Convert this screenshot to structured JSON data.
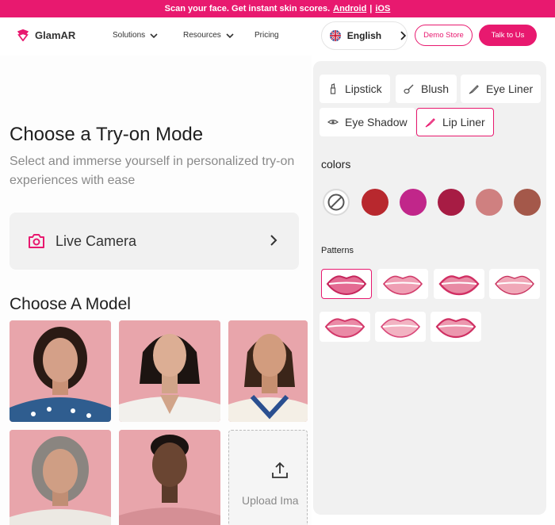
{
  "banner": {
    "text": "Scan your face. Get instant skin scores.",
    "android": "Android",
    "separator": "|",
    "ios": "iOS"
  },
  "nav": {
    "brand": "GlamAR",
    "links": [
      {
        "label": "Solutions"
      },
      {
        "label": "Resources"
      },
      {
        "label": "Pricing"
      }
    ],
    "language": "English",
    "demo_label": "Demo Store",
    "talk_label": "Talk to Us"
  },
  "left": {
    "title": "Choose a Try-on Mode",
    "subtitle": "Select and immerse yourself in personalized try-on experiences with ease",
    "live_camera": "Live Camera",
    "models_title": "Choose A Model",
    "upload_label": "Upload Ima"
  },
  "right": {
    "categories": [
      {
        "label": "Lipstick",
        "icon": "lipstick-icon"
      },
      {
        "label": "Blush",
        "icon": "blush-brush-icon"
      },
      {
        "label": "Eye Liner",
        "icon": "eyeliner-icon"
      },
      {
        "label": "Eye Shadow",
        "icon": "eye-shadow-icon"
      },
      {
        "label": "Lip Liner",
        "icon": "lip-liner-icon"
      }
    ],
    "active_category": "Lip Liner",
    "colors_title": "colors",
    "colors": [
      "none",
      "#b8282e",
      "#c1268a",
      "#a71c44",
      "#cf8080",
      "#a4584a"
    ],
    "patterns_title": "Patterns",
    "pattern_count": 7,
    "accent": "#e8196f"
  }
}
